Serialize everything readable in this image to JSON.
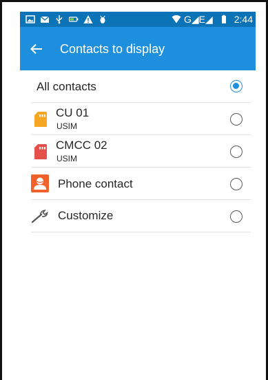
{
  "status_bar": {
    "network": "G◢E◢",
    "time": "2:44",
    "icons": [
      "image-icon",
      "email-icon",
      "usb-icon",
      "battery-saver-icon",
      "warning-icon",
      "debug-icon",
      "wifi-icon",
      "signal-icon",
      "battery-icon"
    ]
  },
  "app_bar": {
    "title": "Contacts to display",
    "back_icon": "arrow-back-icon"
  },
  "list": {
    "items": [
      {
        "label": "All contacts",
        "sublabel": "",
        "icon": "",
        "selected": true
      },
      {
        "label": "CU 01",
        "sublabel": "USIM",
        "icon": "sim-card-icon",
        "icon_color": "#f5a623",
        "selected": false
      },
      {
        "label": "CMCC 02",
        "sublabel": "USIM",
        "icon": "sim-card-icon",
        "icon_color": "#e5504a",
        "selected": false
      },
      {
        "label": "Phone contact",
        "sublabel": "",
        "icon": "phone-contact-icon",
        "icon_color": "#f0612b",
        "selected": false
      },
      {
        "label": "Customize",
        "sublabel": "",
        "icon": "wrench-icon",
        "selected": false
      }
    ]
  },
  "colors": {
    "status_bar": "#0c73b7",
    "app_bar": "#1d8fdd",
    "accent": "#1d8fdd"
  }
}
